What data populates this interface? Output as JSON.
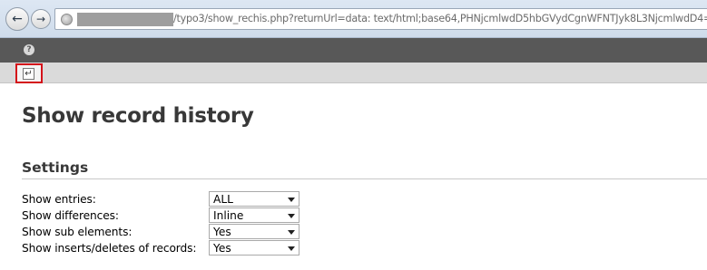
{
  "browser": {
    "back_icon": "back-arrow-icon",
    "forward_icon": "forward-arrow-icon",
    "site_icon": "globe-icon",
    "url": "/typo3/show_rechis.php?returnUrl=data: text/html;base64,PHNjcmlwdD5hbGVydCgnWFNTJyk8L3NjcmlwdD4="
  },
  "topbar": {
    "help_icon": "help-icon"
  },
  "docheader": {
    "return_icon": "return-icon",
    "highlight_color": "#d4121a"
  },
  "content": {
    "title": "Show record history",
    "section_title": "Settings",
    "settings": [
      {
        "label": "Show entries:",
        "value": "ALL"
      },
      {
        "label": "Show differences:",
        "value": "Inline"
      },
      {
        "label": "Show sub elements:",
        "value": "Yes"
      },
      {
        "label": "Show inserts/deletes of records:",
        "value": "Yes"
      }
    ]
  }
}
